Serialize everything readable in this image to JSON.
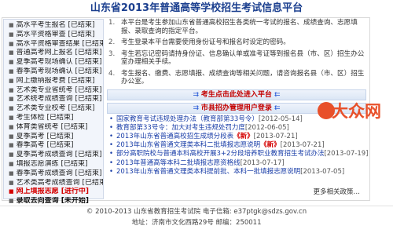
{
  "page": {
    "title": "山东省2013年普通高等学校招生考试信息平台"
  },
  "sidebar": {
    "items": [
      {
        "label": "高水平考生报名 [已结束]",
        "style": "normal"
      },
      {
        "label": "高水平资格审查 [已结束]",
        "style": "normal"
      },
      {
        "label": "高水平资格审查结果 [已结束]",
        "style": "normal"
      },
      {
        "label": "普通高考网上报名 [已结束]",
        "style": "normal"
      },
      {
        "label": "夏季高考现场确认 [已结束]",
        "style": "normal"
      },
      {
        "label": "春季高考现场确认 [已结束]",
        "style": "normal"
      },
      {
        "label": "网上缴纳报考费 [已结束]",
        "style": "normal"
      },
      {
        "label": "艺术类专业省统考 [已结束]",
        "style": "normal"
      },
      {
        "label": "艺术统考成绩查询 [已结束]",
        "style": "normal"
      },
      {
        "label": "艺术类专业校考 [已结束]",
        "style": "normal"
      },
      {
        "label": "考生体检 [已结束]",
        "style": "normal"
      },
      {
        "label": "体育类省统考 [已结束]",
        "style": "normal"
      },
      {
        "label": "夏季高考 [已结束]",
        "style": "normal"
      },
      {
        "label": "春季高考 [已结束]",
        "style": "normal"
      },
      {
        "label": "夏季高考成绩查询 [已结束]",
        "style": "normal"
      },
      {
        "label": "填报志愿演练 [已结束]",
        "style": "normal"
      },
      {
        "label": "春季高考成绩查询 [已结束]",
        "style": "normal"
      },
      {
        "label": "艺术类高考成绩查询 [已结束]",
        "style": "normal"
      },
      {
        "label": "网上填报志愿 [进行中]",
        "style": "red"
      },
      {
        "label": "录取去向查询 [未开始]",
        "style": "bold"
      }
    ]
  },
  "notes": [
    {
      "num": "1.",
      "pre": "本平台是考生参加山东省普通高校招生各类统一考试的报名、成绩查询、志愿填报、录取查询的指定平台。",
      "link": "",
      "post": ""
    },
    {
      "num": "2.",
      "pre": "考生登录本平台需要使用身份证号和报名时设定的密码。",
      "link": "",
      "post": ""
    },
    {
      "num": "3.",
      "pre": "考生若忘记密码请持身份证、信息确认单或准考证等到报名县（市、区）招生办公室办理相关手续。",
      "link": "县（市、区）招生办公室",
      "post": ""
    },
    {
      "num": "4.",
      "pre": "考生报名、缴费、志愿填报、成绩查询等相关问题，请咨询报名县（市、区）招生办公室。",
      "link": "",
      "post": ""
    }
  ],
  "buttons": {
    "student_entry": "考生点击此处进入平台",
    "admin_entry": "市县招办管理用户登录"
  },
  "news": [
    {
      "text": "国家教育考试违规处理办法（教育部第33号令）",
      "date": "[2012-05-14]",
      "is_new": false
    },
    {
      "text": "教育部第33号令：加大对考生违规处罚力度",
      "date": "[2012-06-05]",
      "is_new": false
    },
    {
      "text": "2013年山东省普通高校招生成绩分段表",
      "date": "[2013-07-21]",
      "is_new": true
    },
    {
      "text": "2013年山东省普通文理类本科二批填报志愿说明",
      "date": "[2013-07-21]",
      "is_new": true
    },
    {
      "text": "部分高职院校与普通本科高校开展3+2分段培养职业教育招生考试办法",
      "date": "[2013-07-19]",
      "is_new": false
    },
    {
      "text": "2013年普通高等本科二批填报志愿资格线",
      "date": "[2013-07-17]",
      "is_new": false
    },
    {
      "text": "2013年山东省普通文理类本科提前批、本科一批填报志愿说明",
      "date": "[2013-07-05]",
      "is_new": false
    }
  ],
  "new_badge": "《新》",
  "more_link": "更多相关政策…",
  "footer": {
    "line1": "© 2010-2013 山东省教育招生考试院  电子信箱: e37ptgk@sdzs.gov.cn",
    "line2": "地址：济南市文化西路29号  邮编：250011"
  },
  "logo": {
    "text": "大众网"
  }
}
